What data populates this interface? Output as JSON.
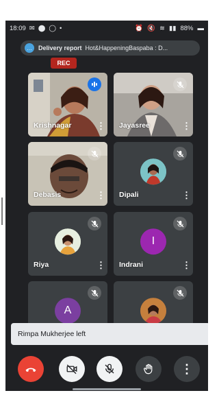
{
  "status": {
    "time": "18:09",
    "battery": "88%"
  },
  "notification": {
    "title": "Delivery report",
    "message": "Hot&HappeningBaspaba : D..."
  },
  "recording": {
    "label": "REC"
  },
  "participants": [
    {
      "name": "Krishnagar",
      "state": "speaking"
    },
    {
      "name": "Jayasree",
      "state": "muted"
    },
    {
      "name": "Debasis",
      "state": "muted"
    },
    {
      "name": "Dipali",
      "state": "muted"
    },
    {
      "name": "Riya",
      "state": "muted"
    },
    {
      "name": "Indrani",
      "state": "muted",
      "avatar_letter": "I",
      "avatar_color": "#9c27b0"
    },
    {
      "name": "",
      "state": "muted",
      "avatar_letter": "A",
      "avatar_color": "#7b3fa0"
    },
    {
      "name": "",
      "state": "muted"
    }
  ],
  "toast": {
    "message": "Rimpa Mukherjee left"
  },
  "controls": {
    "end_call_color": "#ea4335"
  },
  "theme": {
    "background": "#202124",
    "tile": "#3c4043"
  }
}
